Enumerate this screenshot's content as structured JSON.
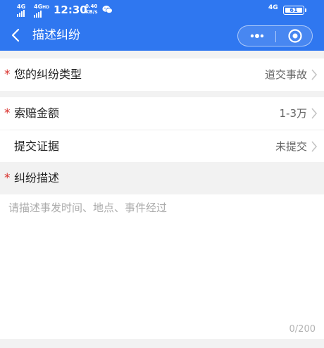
{
  "status_bar": {
    "signal1_label": "4G",
    "signal2_label": "4G",
    "signal2_sub": "HD",
    "time": "12:30",
    "speed_value": "0.40",
    "speed_unit": "KB/s",
    "network": "4G",
    "battery": "61",
    "icons": [
      "signal-icon",
      "signal-icon",
      "wechat-icon",
      "battery-icon"
    ]
  },
  "nav": {
    "title": "描述纠纷",
    "icons": [
      "back-icon",
      "more-dots-icon",
      "close-circle-icon"
    ]
  },
  "form": {
    "dispute_type": {
      "label": "您的纠纷类型",
      "value": "道交事故",
      "required": true
    },
    "claim_amount": {
      "label": "索赔金额",
      "value": "1-3万",
      "required": true
    },
    "evidence": {
      "label": "提交证据",
      "value": "未提交",
      "required": false
    },
    "description": {
      "label": "纠纷描述",
      "placeholder": "请描述事发时间、地点、事件经过",
      "value": "",
      "counter": "0/200",
      "required": true
    }
  },
  "colors": {
    "header": "#2f77f0",
    "required_star": "#d9302b",
    "page_bg": "#f2f2f2"
  }
}
